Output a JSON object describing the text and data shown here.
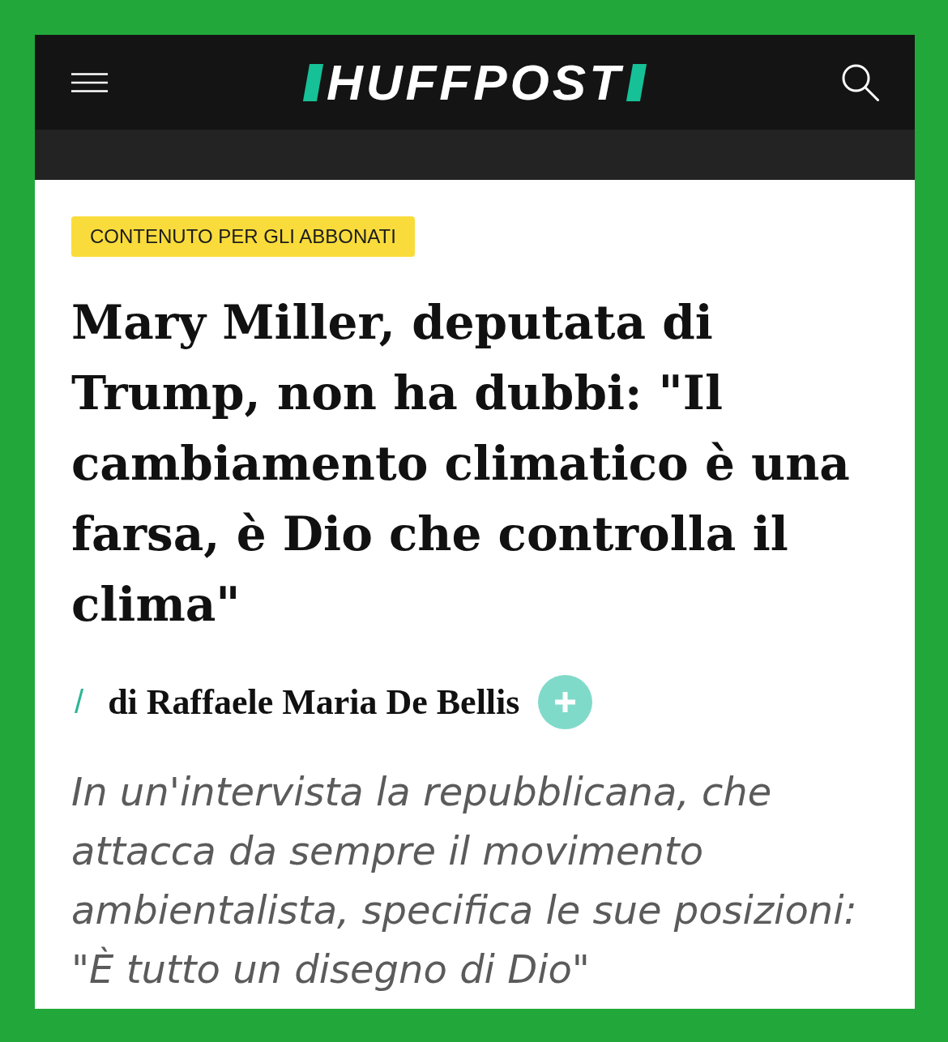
{
  "header": {
    "logo": "HUFFPOST"
  },
  "article": {
    "badge": "CONTENUTO PER GLI ABBONATI",
    "headline": "Mary Miller, deputata di Trump, non ha dubbi: \"Il cambiamento climatico è una farsa, è Dio che controlla il clima\"",
    "byline": {
      "separator": "/",
      "author": "di Raffaele Maria De Bellis"
    },
    "subtitle": "In un'intervista la repubblicana, che attacca da sempre il movimento ambientalista, specifica le sue posizioni: \"È tutto un disegno di Dio\""
  }
}
